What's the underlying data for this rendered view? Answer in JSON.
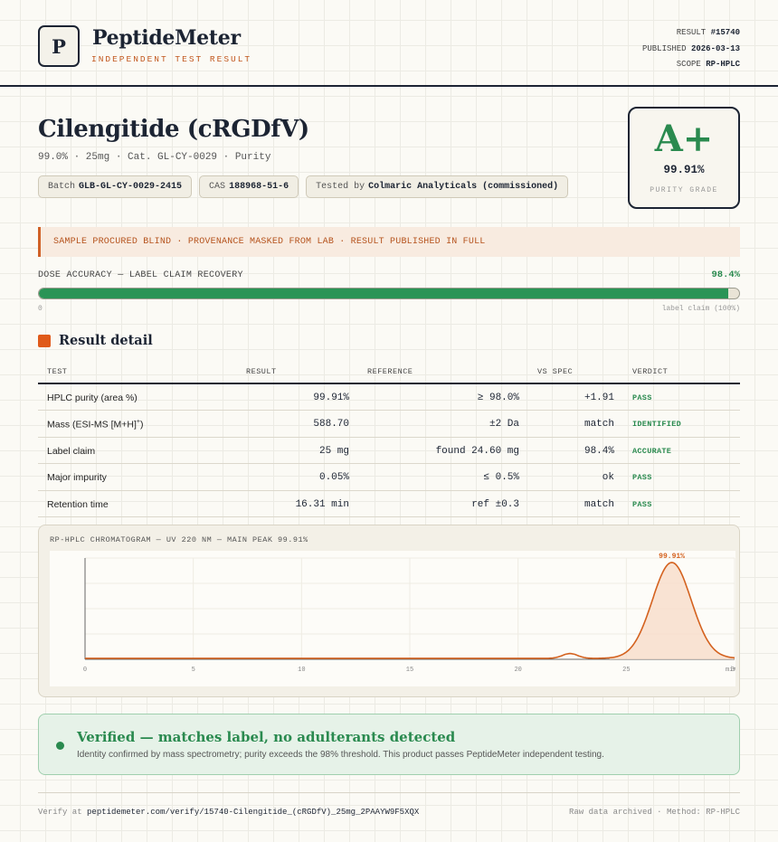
{
  "brand": {
    "logo_letter": "P",
    "name": "PeptideMeter",
    "tagline": "INDEPENDENT TEST RESULT"
  },
  "meta": {
    "result_label": "RESULT",
    "result_value": "#15740",
    "published_label": "PUBLISHED",
    "published_value": "2026-03-13",
    "scope_label": "SCOPE",
    "scope_value": "RP-HPLC"
  },
  "product": {
    "title": "Cilengitide (cRGDfV)",
    "subtitle": "99.0% · 25mg · Cat. GL-CY-0029 · Purity",
    "batch_label": "Batch",
    "batch_value": "GLB-GL-CY-0029-2415",
    "cas_label": "CAS",
    "cas_value": "188968-51-6",
    "tested_label": "Tested by",
    "tested_value": "Colmaric Analyticals (commissioned)"
  },
  "grade": {
    "letter": "A+",
    "value": "99.91%",
    "label": "PURITY GRADE",
    "color": "#2a8a4f"
  },
  "banner": "SAMPLE PROCURED BLIND · PROVENANCE MASKED FROM LAB · RESULT PUBLISHED IN FULL",
  "dose": {
    "label": "DOSE ACCURACY — LABEL CLAIM RECOVERY",
    "value_text": "98.4%",
    "percent": 98.4,
    "zero_label": "0",
    "claim_label": "label claim (100%)"
  },
  "result_detail": {
    "title": "Result detail",
    "headers": [
      "TEST",
      "RESULT",
      "REFERENCE",
      "VS SPEC",
      "VERDICT"
    ],
    "rows": [
      {
        "test": "HPLC purity (area %)",
        "result": "99.91%",
        "reference": "≥ 98.0%",
        "vs_spec": "+1.91",
        "verdict": "PASS"
      },
      {
        "test": "Mass (ESI-MS [M+H]",
        "test_sup": "+",
        "test_suffix": ")",
        "result": "588.70",
        "reference": "±2 Da",
        "vs_spec": "match",
        "verdict": "IDENTIFIED"
      },
      {
        "test": "Label claim",
        "result": "25 mg",
        "reference": "found 24.60 mg",
        "vs_spec": "98.4%",
        "verdict": "ACCURATE"
      },
      {
        "test": "Major impurity",
        "result": "0.05%",
        "reference": "≤ 0.5%",
        "vs_spec": "ok",
        "verdict": "PASS"
      },
      {
        "test": "Retention time",
        "result": "16.31 min",
        "reference": "ref ±0.3",
        "vs_spec": "match",
        "verdict": "PASS"
      }
    ]
  },
  "chromatogram": {
    "title": "RP-HPLC CHROMATOGRAM — UV 220 NM — MAIN PEAK 99.91%",
    "peak_label": "99.91%",
    "line_color": "#d4621f"
  },
  "chart_data": {
    "type": "line",
    "x_ticks": [
      "0",
      "5",
      "10",
      "15",
      "20",
      "25",
      "30"
    ],
    "x_unit_label": "min",
    "xlim": [
      0,
      30
    ],
    "ylim": [
      0,
      100
    ],
    "peaks": [
      {
        "center": 22.4,
        "height": 5,
        "width": 0.35
      },
      {
        "center": 27.1,
        "height": 100,
        "width": 0.9
      }
    ],
    "baseline": 1,
    "annotation": "99.91%"
  },
  "verified": {
    "title": "Verified — matches label, no adulterants detected",
    "text": "Identity confirmed by mass spectrometry; purity exceeds the 98% threshold. This product passes PeptideMeter independent testing."
  },
  "footer": {
    "verify_label": "Verify at",
    "verify_url": "peptidemeter.com/verify/15740-Cilengitide_(cRGDfV)_25mg_2PAAYW9F5XQX",
    "right_text": "Raw data archived · Method: RP-HPLC"
  }
}
